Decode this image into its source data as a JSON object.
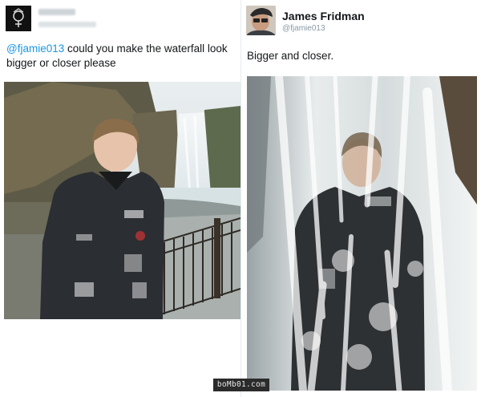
{
  "left_tweet": {
    "mention": "@fjamie013",
    "text": " could you make the waterfall look bigger or closer please",
    "photo_alt": "boy standing in front of a small waterfall"
  },
  "right_tweet": {
    "name": "James Fridman",
    "handle": "@fjamie013",
    "text": "Bigger and closer.",
    "photo_alt": "boy edited into a huge waterfall"
  },
  "watermark": "boMb01.com",
  "colors": {
    "mention": "#1b95e0",
    "handle": "#8899a6",
    "text": "#14171a"
  }
}
